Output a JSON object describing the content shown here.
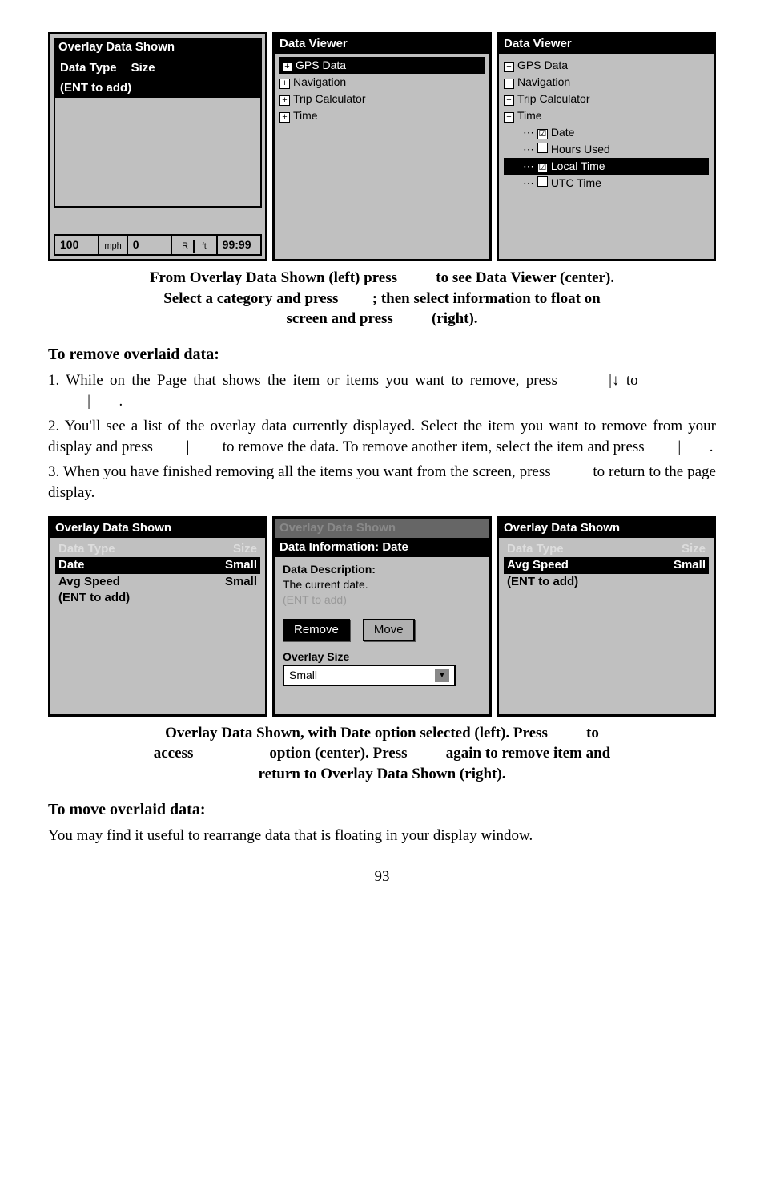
{
  "fig1": {
    "panel1": {
      "title": "Overlay Data Shown",
      "col1": "Data Type",
      "col2": "Size",
      "row1": "(ENT to add)",
      "status": {
        "v1": "100",
        "u1": "mph",
        "v2": "0",
        "u2": "R",
        "u2b": "ft",
        "v3": "99:99"
      }
    },
    "panel2": {
      "title": "Data Viewer",
      "items": {
        "gps": "GPS Data",
        "nav": "Navigation",
        "trip": "Trip Calculator",
        "time": "Time"
      }
    },
    "panel3": {
      "title": "Data Viewer",
      "items": {
        "gps": "GPS Data",
        "nav": "Navigation",
        "trip": "Trip Calculator",
        "time": "Time",
        "date": "Date",
        "hours": "Hours Used",
        "local": "Local Time",
        "utc": "UTC Time"
      }
    },
    "caption": {
      "l1a": "From Overlay Data Shown (left) press ",
      "l1b": " to see Data Viewer (center).",
      "l2a": "Select a category and press ",
      "l2b": "; then select information to float on",
      "l3a": "screen and press ",
      "l3b": " (right)."
    }
  },
  "sec1": {
    "h": "To remove overlaid data:",
    "p1a": "1. While on the Page that shows the item or items you want to remove, press ",
    "p1b": "|",
    "p1arrow": "↓",
    "p1c": " to ",
    "p1d": "|",
    "p1e": ".",
    "p2a": "2. You'll see a list of the overlay data currently displayed. Select the item you want to remove from your display and press ",
    "p2b": "|",
    "p2c": " to remove the data. To remove another item, select the item and press ",
    "p2d": "|",
    "p2e": ".",
    "p3a": "3. When you have finished removing all the items you want from the screen, press ",
    "p3b": " to return to the page display."
  },
  "fig2": {
    "panel1": {
      "title": "Overlay Data Shown",
      "col1": "Data Type",
      "col2": "Size",
      "r1a": "Date",
      "r1b": "Small",
      "r2a": "Avg Speed",
      "r2b": "Small",
      "r3": "(ENT to add)"
    },
    "panel2": {
      "title": "Overlay Data Shown",
      "sub": "Data Information: Date",
      "desc1": "Data Description:",
      "desc2": "The current date.",
      "ghost": "(ENT to add)",
      "btn1": "Remove",
      "btn2": "Move",
      "lbl": "Overlay Size",
      "combo": "Small"
    },
    "panel3": {
      "title": "Overlay Data Shown",
      "col1": "Data Type",
      "col2": "Size",
      "r1a": "Avg Speed",
      "r1b": "Small",
      "r2": "(ENT to add)"
    },
    "caption": {
      "l1a": "Overlay Data Shown, with Date option selected (left). Press ",
      "l1b": " to",
      "l2a": "access ",
      "l2b": " option (center). Press ",
      "l2c": " again to remove item and",
      "l3": "return to Overlay Data Shown (right)."
    }
  },
  "sec2": {
    "h": "To move overlaid data:",
    "p": "You may find it useful to rearrange data that is floating in your display window."
  },
  "page": "93"
}
